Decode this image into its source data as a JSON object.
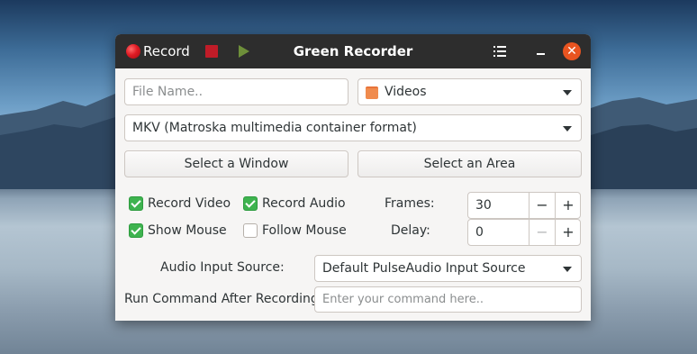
{
  "window": {
    "title": "Green Recorder",
    "record_label": "Record",
    "close_glyph": "✕"
  },
  "form": {
    "filename_placeholder": "File Name..",
    "folder_value": "Videos",
    "format_value": "MKV (Matroska multimedia container format)",
    "select_window_label": "Select a Window",
    "select_area_label": "Select an Area",
    "checkboxes": [
      {
        "label": "Record Video",
        "checked": true
      },
      {
        "label": "Record Audio",
        "checked": true
      },
      {
        "label": "Show Mouse",
        "checked": true
      },
      {
        "label": "Follow Mouse",
        "checked": false
      }
    ],
    "frames_label": "Frames:",
    "frames_value": "30",
    "delay_label": "Delay:",
    "delay_value": "0",
    "minus_glyph": "−",
    "plus_glyph": "+",
    "audio_source_label": "Audio Input Source:",
    "audio_source_value": "Default PulseAudio Input Source",
    "command_label": "Run Command After Recording:",
    "command_placeholder": "Enter your command here.."
  },
  "colors": {
    "accent_green": "#3eb34f",
    "close_orange": "#e95420",
    "record_red": "#e01b24",
    "titlebar": "#2d2d2d"
  },
  "icons": {
    "record": "record-dot-icon",
    "stop": "stop-icon",
    "play": "play-icon",
    "menu": "list-menu-icon",
    "minimize": "minimize-icon",
    "close": "close-icon",
    "folder": "folder-icon",
    "dropdown": "chevron-down-icon"
  }
}
